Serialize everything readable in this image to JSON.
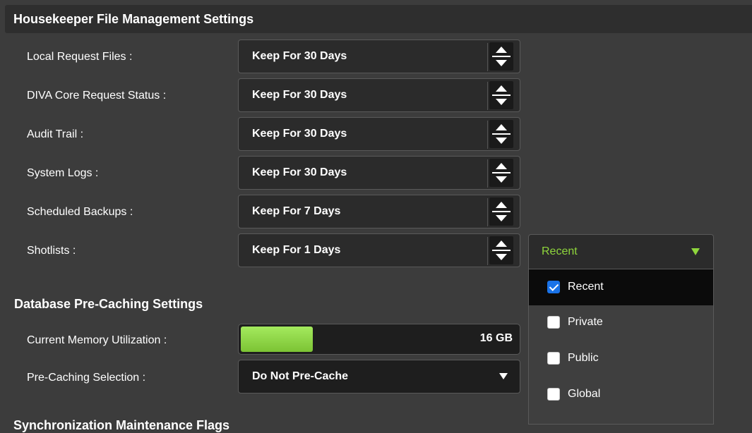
{
  "housekeeper": {
    "title": "Housekeeper File Management Settings",
    "rows": [
      {
        "label": "Local Request Files :",
        "value": "Keep For 30 Days"
      },
      {
        "label": "DIVA Core Request Status :",
        "value": "Keep For 30 Days"
      },
      {
        "label": "Audit Trail :",
        "value": "Keep For 30 Days"
      },
      {
        "label": "System Logs :",
        "value": "Keep For 30 Days"
      },
      {
        "label": "Scheduled Backups :",
        "value": "Keep For 7 Days"
      },
      {
        "label": "Shotlists :",
        "value": "Keep For 1 Days"
      }
    ]
  },
  "precache": {
    "title": "Database Pre-Caching Settings",
    "memory_label": "Current Memory Utilization :",
    "memory_value": "16 GB",
    "memory_fill_fraction": 0.26,
    "selection_label": "Pre-Caching Selection :",
    "selection_value": "Do Not Pre-Cache"
  },
  "sync": {
    "title": "Synchronization Maintenance Flags"
  },
  "shotlist_dropdown": {
    "selected": "Recent",
    "options": [
      {
        "label": "Recent",
        "checked": true
      },
      {
        "label": "Private",
        "checked": false
      },
      {
        "label": "Public",
        "checked": false
      },
      {
        "label": "Global",
        "checked": false
      }
    ]
  },
  "colors": {
    "background": "#3c3c3c",
    "accent_green": "#8fd63c",
    "checkbox_blue": "#1a73e8"
  },
  "icons": {
    "spinner": "spinner-up-down-icon",
    "select_caret": "chevron-down-icon",
    "checkbox": "checkbox-icon"
  }
}
